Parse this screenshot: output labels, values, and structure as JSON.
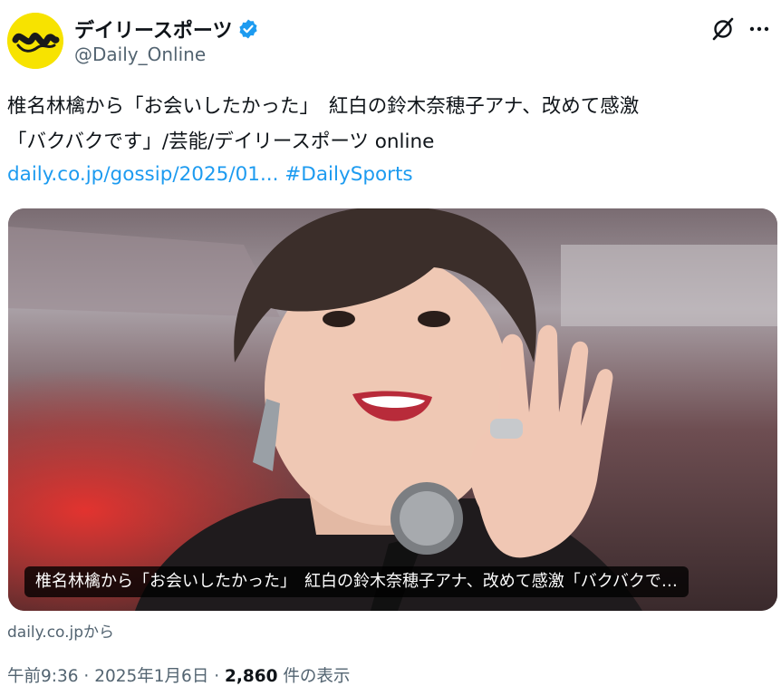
{
  "author": {
    "display_name": "デイリースポーツ",
    "handle": "@Daily_Online",
    "avatar_icon": "daily-sports-logo-icon",
    "verified_icon": "verified-badge-icon",
    "avatar_color": "#f7e300",
    "verified_color": "#1d9bf0"
  },
  "actions": {
    "grok_icon": "grok-icon",
    "more_icon": "more-options-icon"
  },
  "tweet": {
    "line1": "椎名林檎から「お会いしたかった」　紅白の鈴木奈穂子アナ、改めて感激",
    "line2": "「バクバクです」/芸能/デイリースポーツ online",
    "link": "daily.co.jp/gossip/2025/01...",
    "hashtag": "#DailySports",
    "link_color": "#1d9bf0"
  },
  "card": {
    "caption": "椎名林檎から「お会いしたかった」　紅白の鈴木奈穂子アナ、改めて感激「バクバクで…",
    "source": "daily.co.jpから"
  },
  "meta": {
    "time": "午前9:36",
    "sep": " · ",
    "date": "2025年1月6日",
    "views": "2,860",
    "views_label": " 件の表示"
  }
}
